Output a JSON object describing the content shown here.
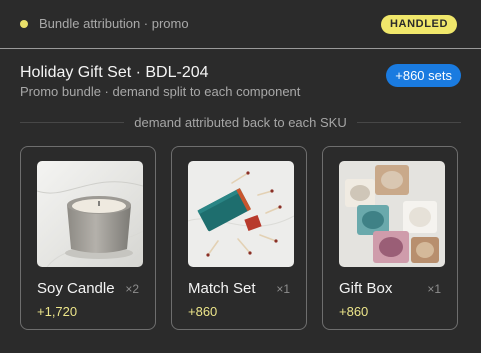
{
  "header": {
    "title": "Bundle attribution · promo",
    "status_badge": "HANDLED"
  },
  "bundle": {
    "title": "Holiday Gift Set · BDL-204",
    "subtitle": "Promo bundle · demand split to each component",
    "sets_delta": "+860 sets"
  },
  "section": {
    "label": "demand attributed back to each SKU"
  },
  "components": [
    {
      "name": "Soy Candle",
      "qty": "×2",
      "delta": "+1,720",
      "image": "candle-photo"
    },
    {
      "name": "Match Set",
      "qty": "×1",
      "delta": "+860",
      "image": "matches-photo"
    },
    {
      "name": "Gift Box",
      "qty": "×1",
      "delta": "+860",
      "image": "giftbox-photo"
    }
  ],
  "colors": {
    "background": "#2b2b2b",
    "accent_yellow": "#f0e76b",
    "accent_blue": "#1a7be0"
  }
}
